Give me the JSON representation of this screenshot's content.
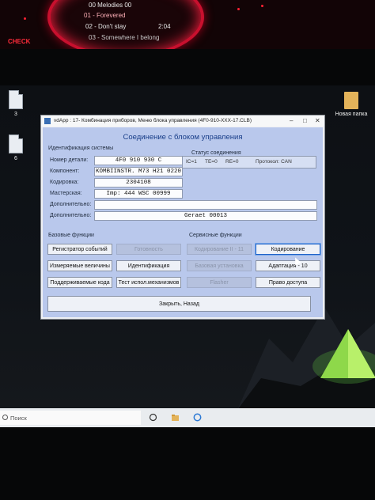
{
  "dashboard": {
    "lines": [
      "00 Melodies 00",
      "01 - Forevered",
      "02 - Don't stay",
      "03 - Somewhere I belong"
    ],
    "times": [
      "2:04"
    ],
    "left_label": "CHECK",
    "colors": {
      "accent": "#c8102e"
    }
  },
  "desktop": {
    "icons": [
      {
        "label": "3",
        "icon": "file-icon"
      },
      {
        "label": "6",
        "icon": "file-icon"
      },
      {
        "label": "Новая папка",
        "icon": "folder-icon"
      }
    ]
  },
  "window": {
    "title": "vdApp : 17- Комбинация приборов,  Меню блока управления (4F0-910-XXX-17.CLB)",
    "header": "Соединение с блоком управления",
    "identification": {
      "group_label": "Идентификация системы",
      "rows": [
        {
          "label": "Номер детали:",
          "value": "4F0 910 930 C"
        },
        {
          "label": "Компонент:",
          "value": "KOMBIINSTR. M73 H21 0220"
        },
        {
          "label": "Кодировка:",
          "value": "2304108"
        },
        {
          "label": "Мастерская:",
          "value": "Imp: 444    WSC 00999"
        },
        {
          "label": "Дополнительно:",
          "value": ""
        },
        {
          "label": "Дополнительно:",
          "value": "Geraet 00013"
        }
      ]
    },
    "connection": {
      "group_label": "Статус соединения",
      "ic": "IC=1",
      "te": "TE=0",
      "re": "RE=0",
      "protocol": "Протокол: CAN"
    },
    "basic_functions": {
      "group_label": "Базовые функции",
      "buttons": [
        {
          "label": "Регистратор событий",
          "enabled": true
        },
        {
          "label": "Готовность",
          "enabled": false
        },
        {
          "label": "Измеряемые величины",
          "enabled": true
        },
        {
          "label": "Идентификация",
          "enabled": true
        },
        {
          "label": "Поддерживаемые кода",
          "enabled": true
        },
        {
          "label": "Тест испол.механизмов",
          "enabled": true
        }
      ]
    },
    "service_functions": {
      "group_label": "Сервисные функции",
      "buttons": [
        {
          "label": "Кодирование II - 11",
          "enabled": false
        },
        {
          "label": "Кодирование",
          "enabled": true
        },
        {
          "label": "Базовая установка",
          "enabled": false
        },
        {
          "label": "Адаптация - 10",
          "enabled": true
        },
        {
          "label": "Flasher",
          "enabled": false
        },
        {
          "label": "Право доступа",
          "enabled": true
        }
      ]
    },
    "close_button": "Закрыть, Назад"
  },
  "taskbar": {
    "search_placeholder": "Поиск"
  }
}
